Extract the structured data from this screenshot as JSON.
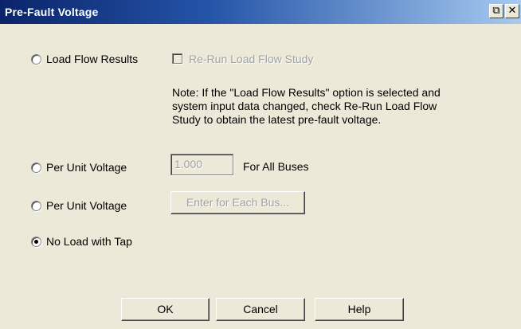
{
  "window": {
    "title": "Pre-Fault Voltage",
    "restore_glyph": "⧉",
    "close_glyph": "✕"
  },
  "options": {
    "load_flow": {
      "label": "Load Flow Results",
      "selected": false
    },
    "rerun": {
      "label": "Re-Run Load Flow Study",
      "checked": false,
      "enabled": false
    },
    "note_lines": [
      "Note:  If the \"Load Flow Results\" option is selected and",
      "system input data changed, check Re-Run Load Flow",
      "Study to obtain the latest pre-fault voltage."
    ],
    "per_unit_all": {
      "label": "Per Unit Voltage",
      "selected": false,
      "value": "1.000",
      "suffix": "For All Buses"
    },
    "per_unit_each": {
      "label": "Per Unit Voltage",
      "selected": false,
      "button_label": "Enter for Each Bus..."
    },
    "no_load_tap": {
      "label": "No Load with Tap",
      "selected": true
    }
  },
  "buttons": {
    "ok": "OK",
    "cancel": "Cancel",
    "help": "Help"
  }
}
